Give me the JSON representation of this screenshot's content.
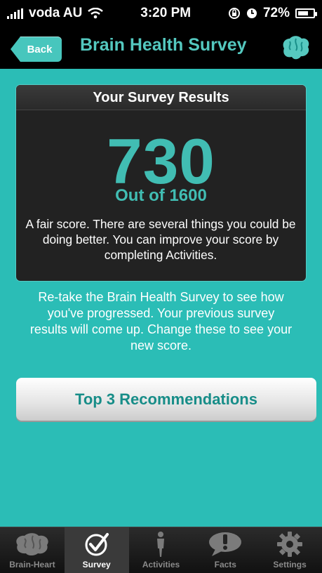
{
  "status_bar": {
    "carrier": "voda AU",
    "time": "3:20 PM",
    "battery": "72%",
    "battery_level": 0.72
  },
  "navbar": {
    "back_label": "Back",
    "title": "Brain Health Survey"
  },
  "results": {
    "title": "Your Survey Results",
    "score": "730",
    "out_of": "Out of 1600",
    "description": "A fair score. There are several things you could be doing better. You can improve your score by completing Activities."
  },
  "info": {
    "text": "Re-take the Brain Health Survey to see how you've progressed. Your previous survey results will come up. Change these to see your new score."
  },
  "recommendations": {
    "label": "Top 3 Recommendations"
  },
  "tabs": [
    {
      "label": "Brain-Heart",
      "icon": "brain-heart-icon",
      "active": false
    },
    {
      "label": "Survey",
      "icon": "survey-check-icon",
      "active": true
    },
    {
      "label": "Activities",
      "icon": "activities-icon",
      "active": false
    },
    {
      "label": "Facts",
      "icon": "facts-icon",
      "active": false
    },
    {
      "label": "Settings",
      "icon": "settings-icon",
      "active": false
    }
  ],
  "colors": {
    "background": "#2bbdb6",
    "accent": "#41bdb3",
    "button_text": "#178d88"
  }
}
